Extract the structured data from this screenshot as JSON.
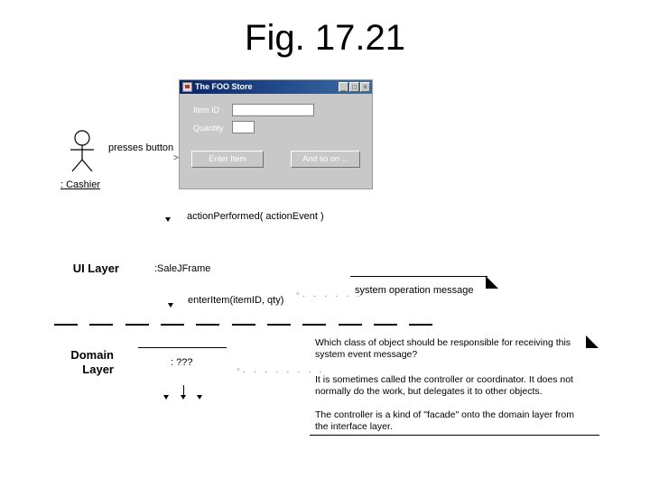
{
  "figure": {
    "title": "Fig. 17.21"
  },
  "actor": {
    "name": ": Cashier",
    "icon": "stick-figure-icon"
  },
  "messages": {
    "presses_button": "presses button",
    "action_performed": "actionPerformed( actionEvent )",
    "enter_item": "enterItem(itemID, qty)"
  },
  "app_window": {
    "title": "The FOO Store",
    "controls": [
      "minimize",
      "maximize",
      "close"
    ],
    "fields": [
      {
        "label": "Item ID",
        "value": ""
      },
      {
        "label": "Quantity",
        "value": ""
      }
    ],
    "buttons": [
      "Enter Item",
      "And so on ..."
    ]
  },
  "layers": {
    "ui": {
      "label": "UI Layer",
      "object": ":SaleJFrame"
    },
    "domain": {
      "label_line1": "Domain",
      "label_line2": "Layer",
      "object": ": ???"
    }
  },
  "notes": {
    "system_operation": "system operation message",
    "question": [
      "Which class of object should be responsible for receiving this",
      "system event message?"
    ],
    "paragraph1": [
      "It is sometimes called the controller or coordinator. It does not",
      "normally do the work, but delegates it to other objects."
    ],
    "paragraph2": [
      "The controller is a kind of \"facade\" onto the domain layer from",
      "the interface layer."
    ]
  }
}
